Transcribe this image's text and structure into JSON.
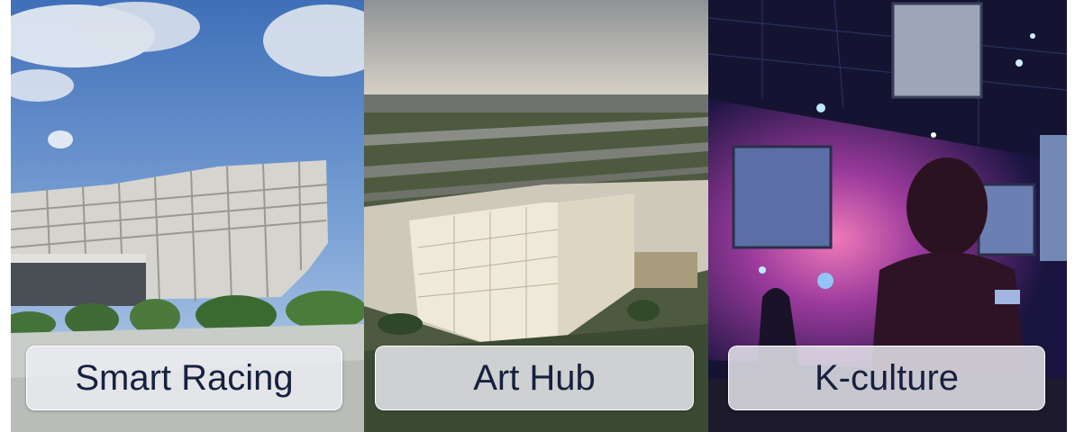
{
  "panels": [
    {
      "label": "Smart Racing",
      "image": "modern-racetrack-building-photo"
    },
    {
      "label": "Art Hub",
      "image": "illuminated-art-hub-building-aerial-photo"
    },
    {
      "label": "K-culture",
      "image": "immersive-digital-gallery-photo"
    }
  ]
}
